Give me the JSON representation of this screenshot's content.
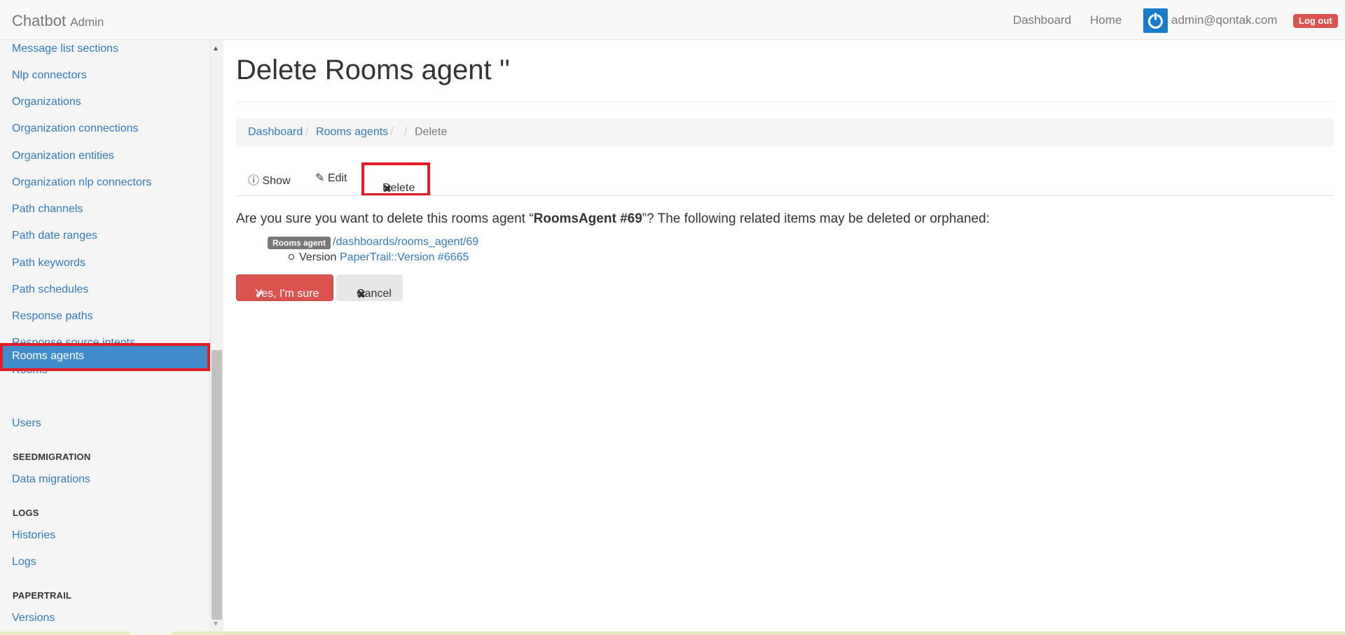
{
  "navbar": {
    "brand": "Chatbot",
    "brand_sub": "Admin",
    "links": {
      "dashboard": "Dashboard",
      "home": "Home"
    },
    "user_email": "admin@qontak.com",
    "logout": "Log out"
  },
  "sidebar": {
    "items": [
      "Message list sections",
      "Nlp connectors",
      "Organizations",
      "Organization connections",
      "Organization entities",
      "Organization nlp connectors",
      "Path channels",
      "Path date ranges",
      "Path keywords",
      "Path schedules",
      "Response paths",
      "Response source intents",
      "Rooms"
    ],
    "active": "Rooms agents",
    "users": "Users",
    "sections": {
      "seedmigration": {
        "title": "SEEDMIGRATION",
        "items": [
          "Data migrations"
        ]
      },
      "logs": {
        "title": "LOGS",
        "items": [
          "Histories",
          "Logs"
        ]
      },
      "papertrail": {
        "title": "PAPERTRAIL",
        "items": [
          "Versions"
        ]
      }
    }
  },
  "main": {
    "title": "Delete Rooms agent ''",
    "breadcrumb": {
      "dashboard": "Dashboard",
      "rooms_agents": "Rooms agents",
      "sep": "/",
      "current": "Delete"
    },
    "tabs": {
      "show": "Show",
      "edit": "Edit",
      "delete": "Delete"
    },
    "confirm_before": "Are you sure you want to delete this rooms agent “",
    "confirm_name": "RoomsAgent #69",
    "confirm_after": "”? The following related items may be deleted or orphaned:",
    "related": {
      "tag": "Rooms agent",
      "link": "/dashboards/rooms_agent/69",
      "version_label": "Version",
      "version_link": "PaperTrail::Version #6665"
    },
    "buttons": {
      "yes": "Yes, I'm sure",
      "cancel": "Cancel"
    }
  }
}
